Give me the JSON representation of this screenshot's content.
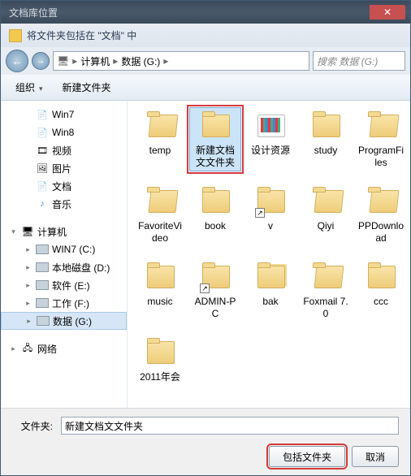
{
  "title": "文档库位置",
  "subtitle": "将文件夹包括在 \"文档\" 中",
  "breadcrumbs": [
    "计算机",
    "数据 (G:)"
  ],
  "search_placeholder": "搜索 数据 (G:)",
  "toolbar": {
    "organize": "组织",
    "newfolder": "新建文件夹"
  },
  "tree": {
    "libs": [
      {
        "label": "Win7",
        "icon": "lib"
      },
      {
        "label": "Win8",
        "icon": "lib"
      },
      {
        "label": "视频",
        "icon": "vid"
      },
      {
        "label": "图片",
        "icon": "pic"
      },
      {
        "label": "文档",
        "icon": "lib"
      },
      {
        "label": "音乐",
        "icon": "mus"
      }
    ],
    "computer": "计算机",
    "drives": [
      {
        "label": "WIN7 (C:)"
      },
      {
        "label": "本地磁盘 (D:)"
      },
      {
        "label": "软件 (E:)"
      },
      {
        "label": "工作 (F:)"
      },
      {
        "label": "数据 (G:)",
        "selected": true
      }
    ],
    "network": "网络"
  },
  "folders": [
    {
      "label": "temp",
      "type": "open"
    },
    {
      "label": "新建文档文文件夹",
      "type": "folder",
      "selected": true,
      "hilite": true
    },
    {
      "label": "设计资源",
      "type": "res"
    },
    {
      "label": "study",
      "type": "folder"
    },
    {
      "label": "ProgramFiles",
      "type": "open"
    },
    {
      "label": "FavoriteVideo",
      "type": "open"
    },
    {
      "label": "book",
      "type": "folder"
    },
    {
      "label": "v",
      "type": "shortcut"
    },
    {
      "label": "Qiyi",
      "type": "open"
    },
    {
      "label": "PPDownload",
      "type": "open"
    },
    {
      "label": "music",
      "type": "folder"
    },
    {
      "label": "ADMIN-PC",
      "type": "shortcut"
    },
    {
      "label": "bak",
      "type": "stack"
    },
    {
      "label": "Foxmail 7.0",
      "type": "open"
    },
    {
      "label": "ccc",
      "type": "folder"
    },
    {
      "label": "2011年会",
      "type": "folder"
    }
  ],
  "filefield": {
    "label": "文件夹:",
    "value": "新建文档文文件夹"
  },
  "buttons": {
    "ok": "包括文件夹",
    "cancel": "取消"
  }
}
